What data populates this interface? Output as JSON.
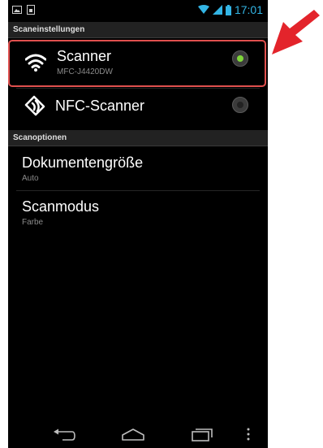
{
  "status_bar": {
    "time": "17:01",
    "icons": [
      "image-icon",
      "sim-card-icon",
      "wifi-signal-icon",
      "cell-signal-icon",
      "battery-icon"
    ]
  },
  "sections": {
    "scan_settings_header": "Scaneinstellungen",
    "scan_options_header": "Scanoptionen"
  },
  "scanner_items": [
    {
      "title": "Scanner",
      "subtitle": "MFC-J4420DW",
      "icon": "wifi-icon",
      "selected": true
    },
    {
      "title": "NFC-Scanner",
      "icon": "nfc-icon",
      "selected": false
    }
  ],
  "scan_options": [
    {
      "title": "Dokumentengröße",
      "value": "Auto"
    },
    {
      "title": "Scanmodus",
      "value": "Farbe"
    }
  ],
  "nav_bar": {
    "icons": [
      "back-icon",
      "home-icon",
      "recent-apps-icon",
      "overflow-menu-icon"
    ]
  },
  "colors": {
    "accent": "#33b5e5",
    "radio_selected": "#7fd63a",
    "highlight": "#e0504e",
    "arrow": "#e3242b"
  }
}
